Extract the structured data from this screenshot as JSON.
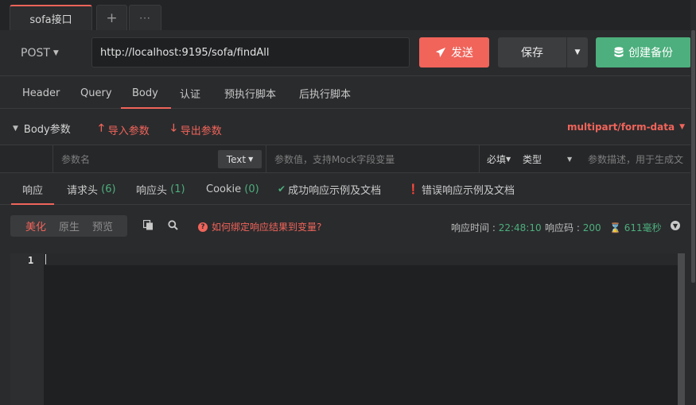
{
  "tabs": {
    "active_label": "sofa接口",
    "plus": "+",
    "more": "···"
  },
  "request": {
    "method": "POST",
    "url": "http://localhost:9195/sofa/findAll",
    "send_label": "发送",
    "save_label": "保存",
    "backup_label": "创建备份"
  },
  "request_tabs": [
    "Header",
    "Query",
    "Body",
    "认证",
    "预执行脚本",
    "后执行脚本"
  ],
  "body": {
    "title": "Body参数",
    "import_label": "导入参数",
    "export_label": "导出参数",
    "form_type": "multipart/form-data"
  },
  "params": {
    "name_placeholder": "参数名",
    "type_label": "Text",
    "value_placeholder": "参数值，支持Mock字段变量",
    "required_label": "必填",
    "kind_label": "类型",
    "desc_placeholder": "参数描述，用于生成文"
  },
  "response_tabs": {
    "response": "响应",
    "req_headers": "请求头",
    "req_headers_count": "(6)",
    "resp_headers": "响应头",
    "resp_headers_count": "(1)",
    "cookie": "Cookie",
    "cookie_count": "(0)",
    "success_doc": "成功响应示例及文档",
    "error_doc": "错误响应示例及文档"
  },
  "response_tool": {
    "beautify": "美化",
    "raw": "原生",
    "preview": "预览",
    "help_text": "如何绑定响应结果到变量?",
    "time_label": "响应时间 :",
    "time_value": "22:48:10",
    "code_label": "响应码 :",
    "code_value": "200",
    "duration_value": "611毫秒"
  },
  "editor": {
    "line_number": "1"
  },
  "colors": {
    "accent_red": "#f0645a",
    "accent_green": "#4caf7d",
    "background": "#2a2b2d"
  }
}
